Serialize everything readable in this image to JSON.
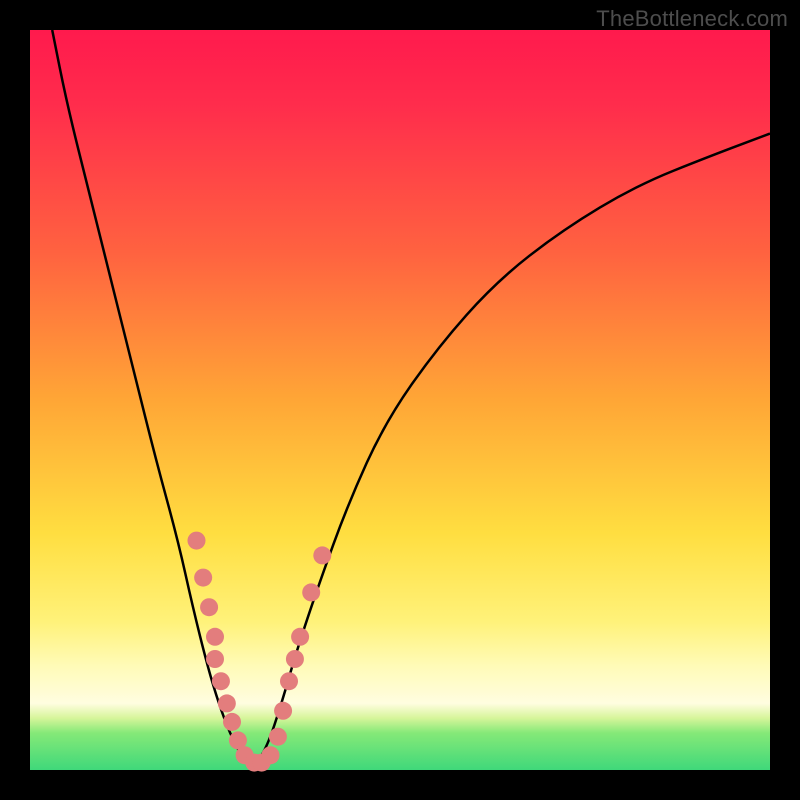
{
  "watermark": "TheBottleneck.com",
  "colors": {
    "background": "#000000",
    "curve": "#000000",
    "dot_fill": "#e37d7d",
    "dot_stroke": "#c96a6a"
  },
  "chart_data": {
    "type": "line",
    "title": "",
    "xlabel": "",
    "ylabel": "",
    "xlim": [
      0,
      100
    ],
    "ylim": [
      0,
      100
    ],
    "series": [
      {
        "name": "bottleneck-curve-left",
        "x": [
          3,
          5,
          8,
          11,
          14,
          17,
          20,
          22,
          24,
          25.5,
          27,
          28.5,
          30
        ],
        "y": [
          100,
          90,
          78,
          66,
          54,
          42,
          31,
          22,
          14,
          9,
          5,
          2,
          0
        ]
      },
      {
        "name": "bottleneck-curve-right",
        "x": [
          30,
          32,
          34,
          36,
          39,
          43,
          48,
          55,
          63,
          72,
          82,
          92,
          100
        ],
        "y": [
          0,
          3,
          9,
          16,
          25,
          36,
          47,
          57,
          66,
          73,
          79,
          83,
          86
        ]
      }
    ],
    "scatter": [
      {
        "name": "highlight-dots",
        "points": [
          {
            "x": 22.5,
            "y": 31
          },
          {
            "x": 23.4,
            "y": 26
          },
          {
            "x": 24.2,
            "y": 22
          },
          {
            "x": 25.0,
            "y": 18
          },
          {
            "x": 25.0,
            "y": 15
          },
          {
            "x": 25.8,
            "y": 12
          },
          {
            "x": 26.6,
            "y": 9
          },
          {
            "x": 27.3,
            "y": 6.5
          },
          {
            "x": 28.1,
            "y": 4
          },
          {
            "x": 29.0,
            "y": 2
          },
          {
            "x": 30.3,
            "y": 1
          },
          {
            "x": 31.3,
            "y": 1
          },
          {
            "x": 32.5,
            "y": 2
          },
          {
            "x": 33.5,
            "y": 4.5
          },
          {
            "x": 34.2,
            "y": 8
          },
          {
            "x": 35.0,
            "y": 12
          },
          {
            "x": 35.8,
            "y": 15
          },
          {
            "x": 36.5,
            "y": 18
          },
          {
            "x": 38.0,
            "y": 24
          },
          {
            "x": 39.5,
            "y": 29
          }
        ]
      }
    ]
  }
}
